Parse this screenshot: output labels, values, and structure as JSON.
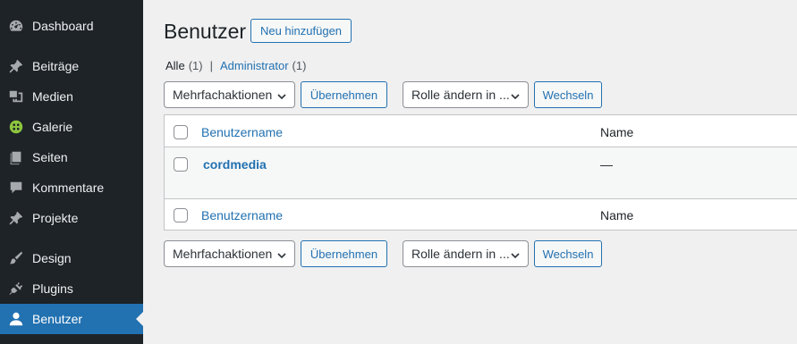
{
  "sidebar": {
    "items": [
      {
        "label": "Dashboard",
        "icon": "dashboard-icon"
      },
      {
        "label": "Beiträge",
        "icon": "pin-icon"
      },
      {
        "label": "Medien",
        "icon": "media-icon"
      },
      {
        "label": "Galerie",
        "icon": "gallery-icon"
      },
      {
        "label": "Seiten",
        "icon": "pages-icon"
      },
      {
        "label": "Kommentare",
        "icon": "comment-icon"
      },
      {
        "label": "Projekte",
        "icon": "pin-icon"
      },
      {
        "label": "Design",
        "icon": "brush-icon"
      },
      {
        "label": "Plugins",
        "icon": "plugin-icon"
      },
      {
        "label": "Benutzer",
        "icon": "user-icon"
      }
    ],
    "active": "Benutzer"
  },
  "header": {
    "title": "Benutzer",
    "add_new_label": "Neu hinzufügen"
  },
  "filters": {
    "all_label": "Alle",
    "all_count": "(1)",
    "separator": "|",
    "admin_label": "Administrator",
    "admin_count": "(1)"
  },
  "top_actions": {
    "bulk_select": "Mehrfachaktionen",
    "apply_label": "Übernehmen",
    "role_select": "Rolle ändern in ...",
    "change_label": "Wechseln"
  },
  "bottom_actions": {
    "bulk_select": "Mehrfachaktionen",
    "apply_label": "Übernehmen",
    "role_select": "Rolle ändern in ...",
    "change_label": "Wechseln"
  },
  "table": {
    "columns": [
      "Benutzername",
      "Name"
    ],
    "rows": [
      {
        "username": "cordmedia",
        "name": "—"
      }
    ]
  },
  "colors": {
    "sidebar_bg": "#1d2327",
    "accent": "#2271b1",
    "page_bg": "#f0f0f1"
  }
}
